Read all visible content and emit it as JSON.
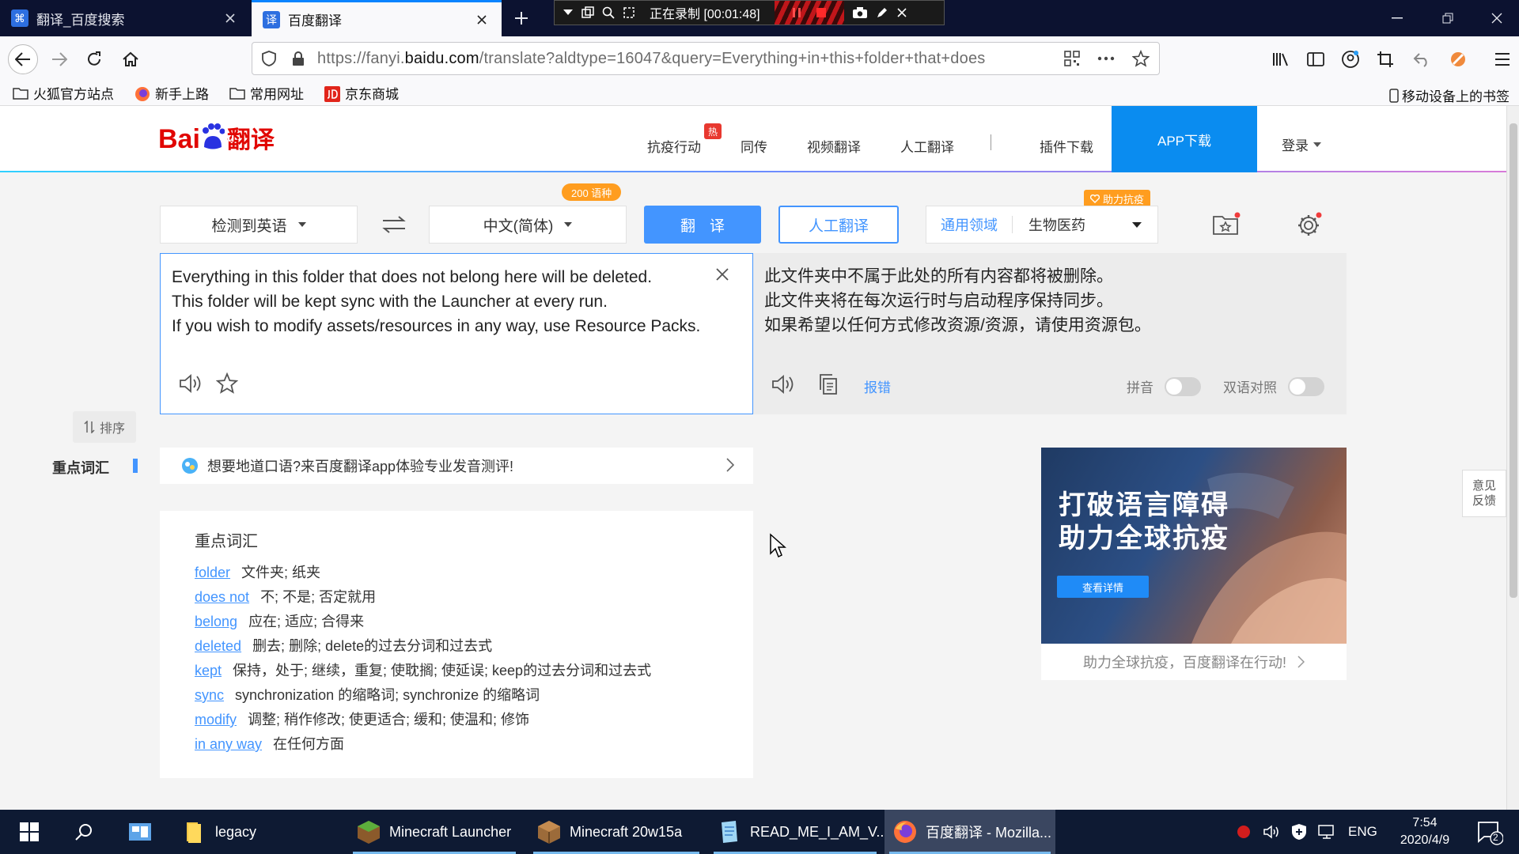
{
  "browser": {
    "tabs": [
      {
        "label": "翻译_百度搜索",
        "active": false
      },
      {
        "label": "百度翻译",
        "active": true
      }
    ],
    "recorder": {
      "status": "正在录制 [00:01:48]"
    },
    "url_prefix": "https://fanyi.",
    "url_domain": "baidu.com",
    "url_suffix": "/translate?aldtype=16047&query=Everything+in+this+folder+that+does",
    "bookmarks": [
      "火狐官方站点",
      "新手上路",
      "常用网址",
      "京东商城"
    ],
    "mobile_bookmarks": "移动设备上的书签"
  },
  "page": {
    "logo": {
      "bai": "Bai",
      "du": "du",
      "fy": "翻译"
    },
    "nav": {
      "items": [
        "抗疫行动",
        "同传",
        "视频翻译",
        "人工翻译",
        "插件下载"
      ],
      "hot_badge": "热",
      "app_download": "APP下载",
      "login": "登录"
    },
    "controls": {
      "source_lang": "检测到英语",
      "target_lang": "中文(简体)",
      "lang_count_badge": "200 语种",
      "translate": "翻译",
      "human_translate": "人工翻译",
      "domain_general": "通用领域",
      "domain_selected": "生物医药",
      "help_badge": "助力抗疫"
    },
    "input_text": "Everything in this folder that does not belong here will be deleted.\nThis folder will be kept sync with the Launcher at every run.\nIf you wish to modify assets/resources in any way, use Resource Packs.",
    "output_text": "此文件夹中不属于此处的所有内容都将被删除。\n此文件夹将在每次运行时与启动程序保持同步。\n如果希望以任何方式修改资源/资源，请使用资源包。",
    "output_tools": {
      "report": "报错",
      "pinyin": "拼音",
      "bilingual": "双语对照",
      "pinyin_on": false,
      "bilingual_on": false
    },
    "sidebar": {
      "sort": "排序",
      "key_vocab": "重点词汇"
    },
    "promo": "想要地道口语?来百度翻译app体验专业发音测评!",
    "vocab": {
      "title": "重点词汇",
      "items": [
        {
          "word": "folder",
          "meaning": "文件夹; 纸夹"
        },
        {
          "word": "does not",
          "meaning": "不; 不是; 否定就用"
        },
        {
          "word": "belong",
          "meaning": "应在; 适应; 合得来"
        },
        {
          "word": "deleted",
          "meaning": "删去; 删除; delete的过去分词和过去式"
        },
        {
          "word": "kept",
          "meaning": "保持，处于; 继续，重复; 使耽搁; 使延误; keep的过去分词和过去式"
        },
        {
          "word": "sync",
          "meaning": "synchronization 的缩略词; synchronize 的缩略词"
        },
        {
          "word": "modify",
          "meaning": "调整; 稍作修改; 使更适合; 缓和; 使温和; 修饰"
        },
        {
          "word": "in any way",
          "meaning": "在任何方面"
        }
      ]
    },
    "ad": {
      "title": "打破语言障碍\n助力全球抗疫",
      "button": "查看详情",
      "footer": "助力全球抗疫，百度翻译在行动!"
    },
    "feedback": "意见\n反馈"
  },
  "taskbar": {
    "items": [
      "legacy",
      "Minecraft Launcher",
      "Minecraft 20w15a",
      "READ_ME_I_AM_V...",
      "百度翻译 - Mozilla..."
    ],
    "lang": "ENG",
    "time": "7:54",
    "date": "2020/4/9",
    "notifications": "2"
  },
  "colors": {
    "accent": "#4395ff",
    "app_download_bg": "#0a8cf0",
    "logo_red": "#e10601",
    "logo_blue": "#2932e1",
    "badge_orange": "#ff9d1f"
  }
}
